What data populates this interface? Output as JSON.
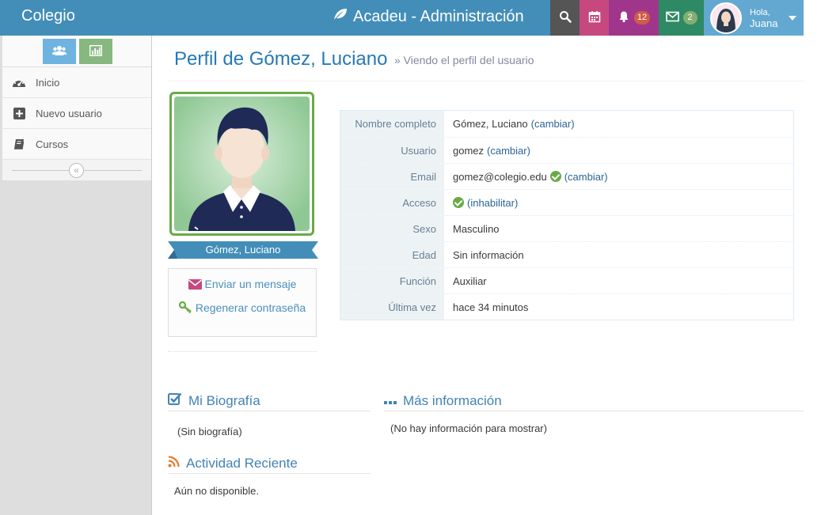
{
  "navbar": {
    "brand_left": "Colegio",
    "brand_center": "Acadeu - Administración",
    "notifications_count": "12",
    "messages_count": "2",
    "user_greeting": "Hola,",
    "user_name": "Juana"
  },
  "sidebar": {
    "items": [
      {
        "label": "Inicio",
        "icon": "dashboard-icon"
      },
      {
        "label": "Nuevo usuario",
        "icon": "plus-square-icon"
      },
      {
        "label": "Cursos",
        "icon": "book-icon"
      }
    ]
  },
  "page": {
    "title": "Perfil de Gómez, Luciano",
    "subtitle": "» Viendo el perfil del usuario"
  },
  "profile": {
    "display_name": "Gómez, Luciano",
    "send_message": "Enviar un mensaje",
    "regen_password": "Regenerar contraseña"
  },
  "info": {
    "full_name_label": "Nombre completo",
    "full_name": "Gómez, Luciano",
    "username_label": "Usuario",
    "username": "gomez",
    "email_label": "Email",
    "email": "gomez@colegio.edu",
    "access_label": "Acceso",
    "disable_link": "(inhabilitar)",
    "sex_label": "Sexo",
    "sex": "Masculino",
    "age_label": "Edad",
    "age": "Sin información",
    "role_label": "Función",
    "role": "Auxiliar",
    "last_seen_label": "Última vez",
    "last_seen": "hace 34 minutos",
    "change_link": "(cambiar)"
  },
  "sections": {
    "bio_title": "Mi Biografía",
    "bio_text": "(Sin biografía)",
    "more_title": "Más información",
    "more_text": "(No hay información para mostrar)",
    "activity_title": "Actividad Reciente",
    "activity_text": "Aún no disponible."
  },
  "colors": {
    "primary": "#438eb9",
    "calendar": "#c6487e",
    "bell": "#a0368b",
    "mail": "#2e8965",
    "user": "#62a8d1",
    "success": "#69aa46"
  }
}
